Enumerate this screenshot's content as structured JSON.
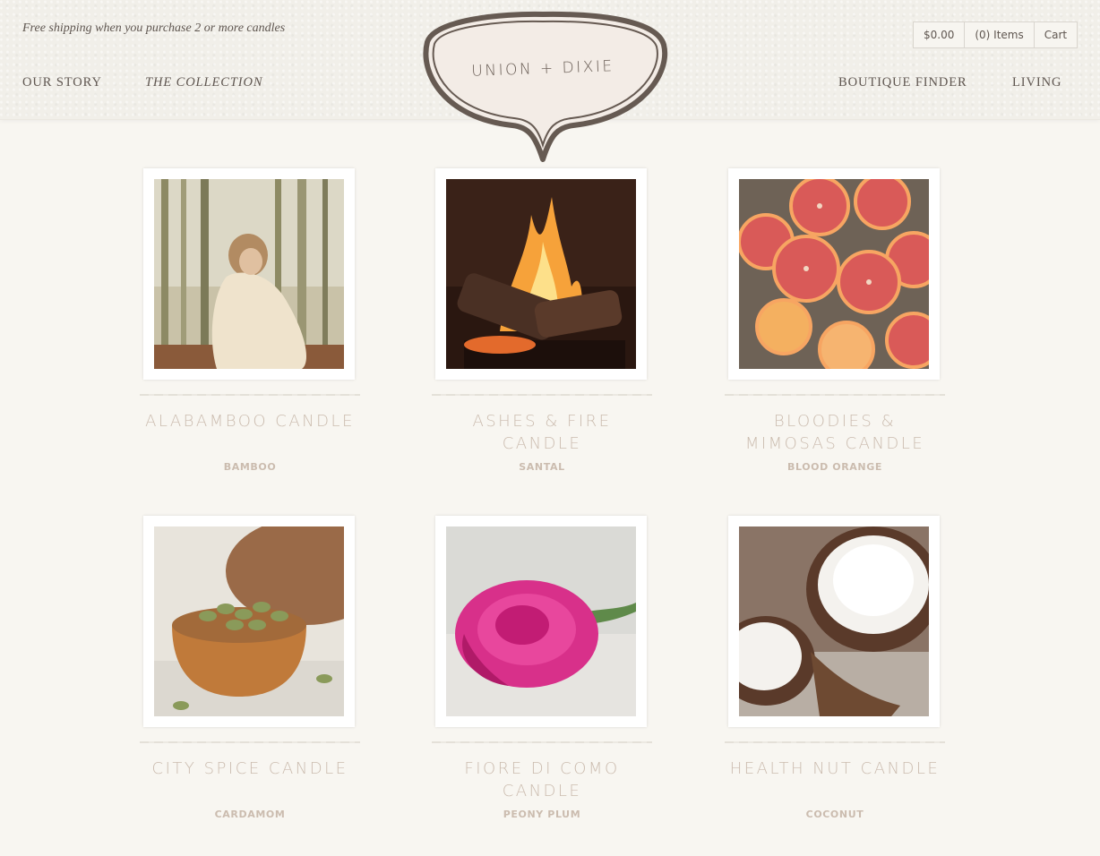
{
  "header": {
    "promo": "Free shipping when you purchase 2 or more candles",
    "nav_left": [
      "Our Story",
      "The Collection"
    ],
    "nav_right": [
      "Boutique Finder",
      "Living"
    ],
    "logo_text": "UNION + DIXIE",
    "cart": {
      "total": "$0.00",
      "items": "(0) Items",
      "label": "Cart"
    }
  },
  "products": [
    {
      "name": "Alabamboo Candle",
      "scent": "BAMBOO"
    },
    {
      "name": "Ashes & Fire Candle",
      "scent": "SANTAL"
    },
    {
      "name": "Bloodies & Mimosas Candle",
      "scent": "BLOOD ORANGE"
    },
    {
      "name": "City Spice Candle",
      "scent": "CARDAMOM"
    },
    {
      "name": "Fiore di Como Candle",
      "scent": "PEONY PLUM"
    },
    {
      "name": "Health Nut Candle",
      "scent": "COCONUT"
    }
  ],
  "colors": {
    "background": "#f8f6f1",
    "header": "#f1efe9",
    "text": "#5f5650",
    "product_text": "#cbbcaf"
  }
}
